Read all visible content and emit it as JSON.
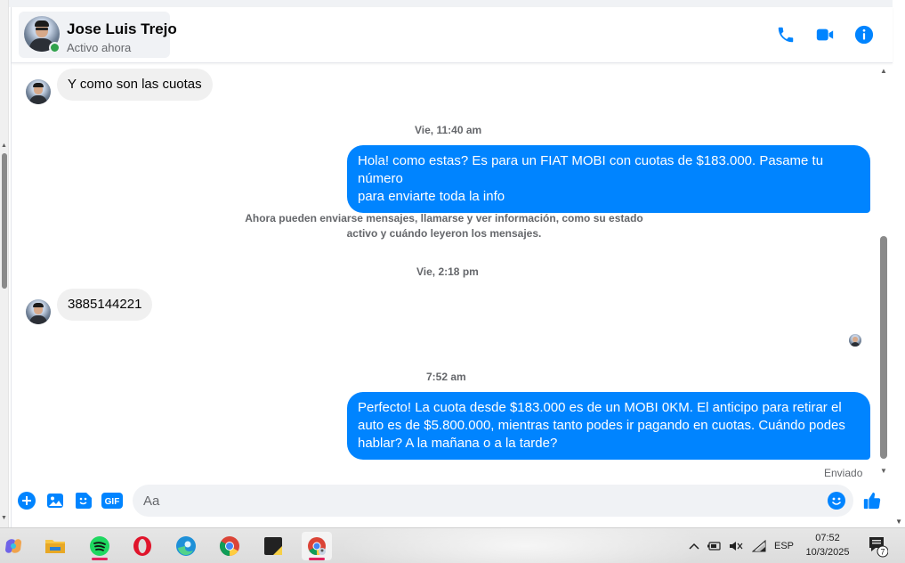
{
  "header": {
    "contact_name": "Jose Luis Trejo",
    "contact_status": "Activo ahora",
    "icons": [
      "phone-icon",
      "video-camera-icon",
      "info-icon"
    ]
  },
  "messages": [
    {
      "direction": "in",
      "text": "Y como son las cuotas"
    },
    {
      "type": "timestamp",
      "text": "Vie, 11:40 am"
    },
    {
      "direction": "out",
      "lines": [
        "Hola! como estas? Es para un FIAT MOBI con cuotas de $183.000. Pasame tu número",
        "para enviarte toda la info"
      ]
    },
    {
      "type": "system",
      "lines": [
        "Ahora pueden enviarse mensajes, llamarse y ver información, como su estado",
        "activo y cuándo leyeron los mensajes."
      ]
    },
    {
      "type": "timestamp",
      "text": "Vie, 2:18 pm"
    },
    {
      "direction": "in",
      "text": "3885144221"
    },
    {
      "type": "timestamp",
      "text": "7:52 am"
    },
    {
      "direction": "out",
      "lines": [
        "Perfecto! La cuota desde $183.000 es de un MOBI 0KM. El anticipo para retirar el",
        "auto es de $5.800.000, mientras tanto podes ir pagando en cuotas. Cuándo podes",
        "hablar? A la mañana o a la tarde?"
      ]
    }
  ],
  "delivery_status": "Enviado",
  "composer": {
    "placeholder": "Aa",
    "icons": [
      "plus-icon",
      "image-icon",
      "sticker-icon",
      "gif-icon",
      "emoji-icon",
      "like-icon"
    ],
    "gif_label": "GIF"
  },
  "colors": {
    "accent": "#0084ff",
    "incoming_bubble": "#f0f0f0",
    "online": "#31a24c"
  },
  "taskbar": {
    "apps": [
      "copilot-icon",
      "file-explorer-icon",
      "spotify-icon",
      "opera-icon",
      "edge-icon",
      "chrome-icon",
      "sticky-notes-icon",
      "chrome-profile-icon"
    ],
    "tray": {
      "language": "ESP",
      "time": "07:52",
      "date": "10/3/2025",
      "notification_count": "7"
    }
  }
}
